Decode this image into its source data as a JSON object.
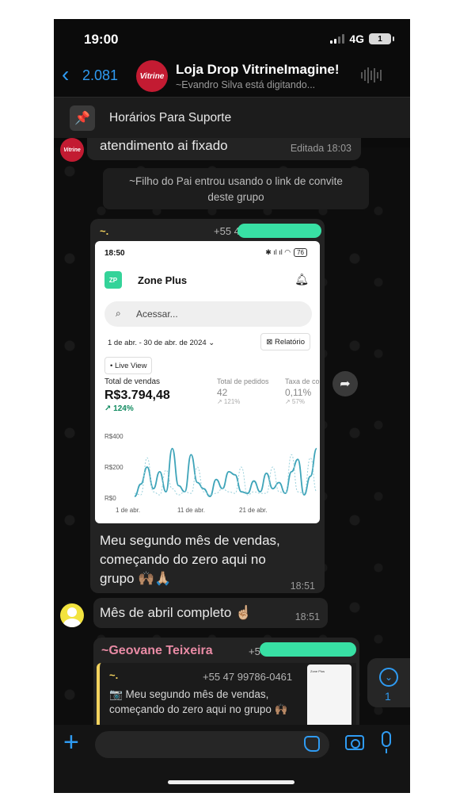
{
  "status_bar": {
    "time": "19:00",
    "network": "4G",
    "battery": "1"
  },
  "header": {
    "back_count": "2.081",
    "group_avatar_text": "Vitrine",
    "title": "Loja Drop VitrineImagine!",
    "subtitle": "~Evandro Silva está digitando..."
  },
  "pinned": {
    "text": "Horários Para Suporte"
  },
  "messages": {
    "top": {
      "text": "atendimento ai fixado",
      "time": "Editada 18:03"
    },
    "system": {
      "line1": "~Filho do Pai entrou usando o link de convite",
      "line2": "deste grupo"
    },
    "image_msg": {
      "sender": "~.",
      "phone": "+55 4",
      "caption_lines": [
        "Meu segundo mês de vendas,",
        "começando do zero aqui no",
        "grupo 🙌🏽🙏🏼"
      ],
      "time": "18:51"
    },
    "short": {
      "text": "Mês de abril completo ☝🏼",
      "time": "18:51"
    },
    "quote_msg": {
      "sender": "~Geovane Teixeira",
      "phone": "+5",
      "quoted_sender": "~.",
      "quoted_phone": "+55 47 99786-0461",
      "quoted_text": "📷 Meu segundo mês de vendas, começando do zero aqui no grupo 🙌🏽",
      "thumb_label": "Zone Plus"
    }
  },
  "screenshot": {
    "time": "18:50",
    "battery": "76",
    "logo": "ZP",
    "app_name": "Zone Plus",
    "search_placeholder": "Acessar...",
    "date_range": "1 de abr. - 30 de abr. de 2024 ⌄",
    "report": "Relatório",
    "live_view": "Live View",
    "kpis": {
      "sales_label": "Total de vendas",
      "sales_value": "R$3.794,48",
      "sales_change": "↗ 124%",
      "orders_label": "Total de pedidos",
      "orders_value": "42",
      "orders_change": "↗ 121%",
      "rate_label": "Taxa de co",
      "rate_value": "0,11%",
      "rate_change": "↗ 57%"
    }
  },
  "chart_data": {
    "type": "line",
    "yticks": [
      "R$400",
      "R$200",
      "R$0"
    ],
    "xticks": [
      "1 de abr.",
      "11 de abr.",
      "21 de abr."
    ],
    "ylim": [
      0,
      400
    ],
    "series": [
      {
        "values": [
          10,
          90,
          200,
          60,
          170,
          40,
          320,
          80,
          40,
          280,
          100,
          60,
          10,
          120,
          60,
          170,
          150,
          40,
          30,
          110,
          40,
          160,
          60,
          100,
          30,
          170,
          250,
          20,
          140,
          320
        ],
        "color": "#3ea4b9",
        "style": "solid"
      },
      {
        "values": [
          30,
          20,
          260,
          40,
          20,
          180,
          60,
          20,
          40,
          30,
          200,
          40,
          20,
          30,
          60,
          40,
          30,
          200,
          20,
          40,
          30,
          30,
          200,
          40,
          30,
          280,
          40,
          30,
          260,
          40
        ],
        "color": "#9ad1dc",
        "style": "dashed"
      }
    ]
  },
  "input": {
    "placeholder": ""
  },
  "scroll": {
    "count": "1"
  },
  "colors": {
    "accent": "#2f9bf2",
    "redact": "#38e0a4",
    "sender_yellow": "#f4d35e",
    "sender_pink": "#e98ba5"
  }
}
